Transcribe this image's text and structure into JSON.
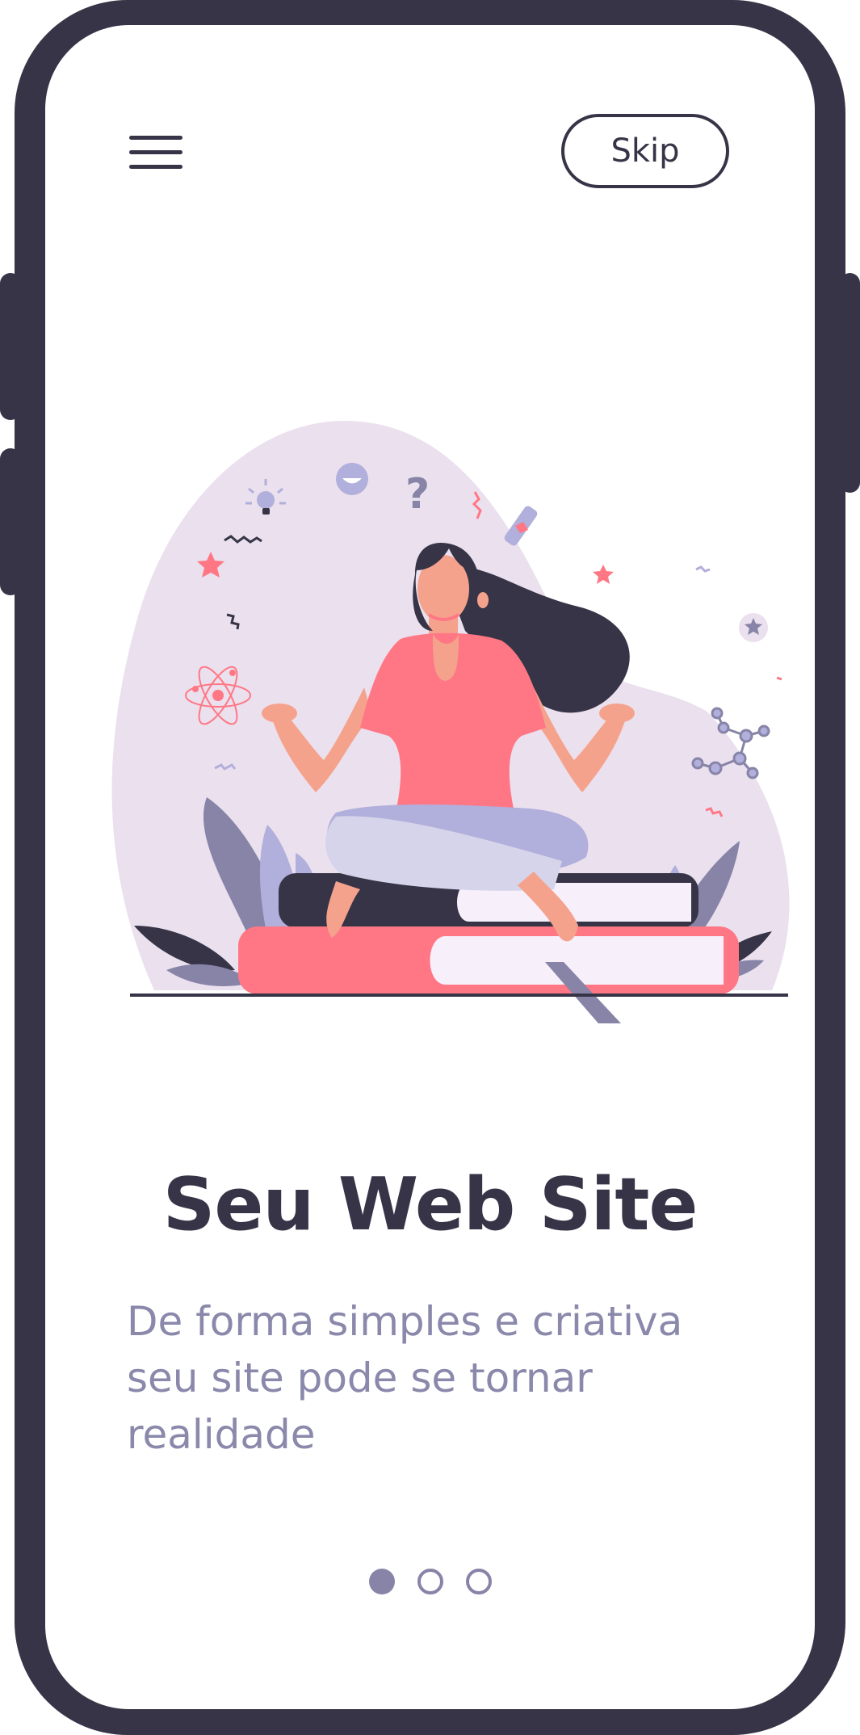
{
  "colors": {
    "frame": "#363446",
    "accent": "#ff7785",
    "muted_text": "#8a88ab",
    "blob": "#ebe0ee",
    "lavender": "#b1afdb",
    "dot": "#8784a8"
  },
  "header": {
    "menu_icon": "hamburger-menu-icon",
    "skip_label": "Skip"
  },
  "content": {
    "title": "Seu Web Site",
    "subtitle_lines": [
      "De forma simples e criativa",
      "seu site pode se tornar",
      "realidade"
    ]
  },
  "pagination": {
    "pages": 3,
    "current": 1
  }
}
